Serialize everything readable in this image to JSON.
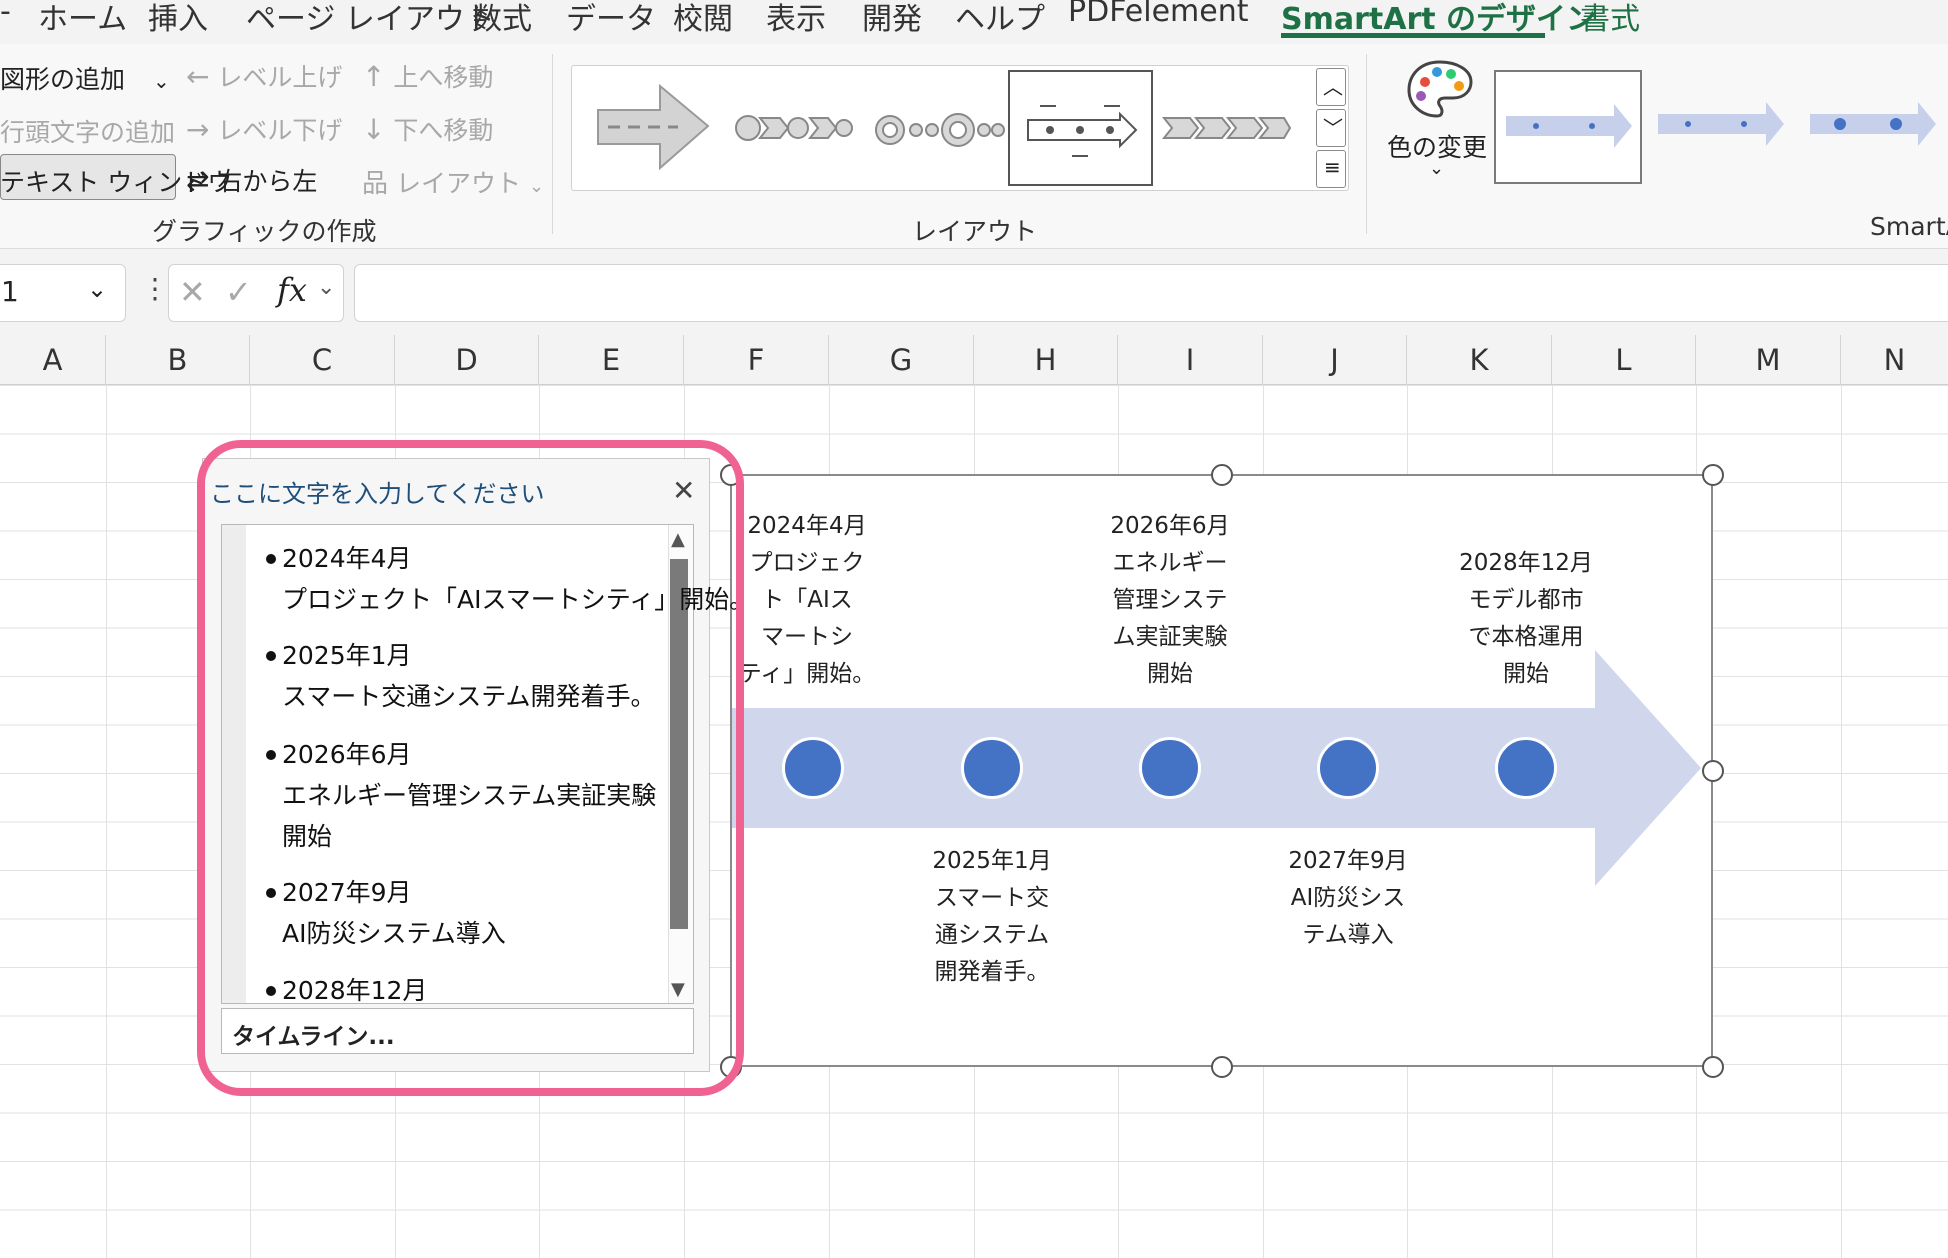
{
  "ribbon_tabs": [
    "ホーム",
    "挿入",
    "ページ レイアウト",
    "数式",
    "データ",
    "校閲",
    "表示",
    "開発",
    "ヘルプ",
    "PDFelement",
    "SmartArt のデザイン",
    "書式"
  ],
  "create_graphic": {
    "add_shape": "図形の追加",
    "add_bullet": "行頭文字の追加",
    "text_pane": "テキスト ウィンドウ",
    "promote": "レベル上げ",
    "demote": "レベル下げ",
    "right_to_left": "右から左",
    "move_up": "上へ移動",
    "move_down": "下へ移動",
    "layout": "レイアウト",
    "group_label": "グラフィックの作成"
  },
  "layouts": {
    "group_label": "レイアウト"
  },
  "color_change": "色の変更",
  "styles_group_label": "SmartA",
  "name_box_value": "1",
  "fx_label": "fx",
  "columns": [
    "A",
    "B",
    "C",
    "D",
    "E",
    "F",
    "G",
    "H",
    "I",
    "J",
    "K",
    "L",
    "M",
    "N"
  ],
  "text_pane": {
    "title": "ここに文字を入力してください",
    "items": [
      {
        "line1": "2024年4月",
        "line2": "プロジェクト「AIスマートシティ」開始。"
      },
      {
        "line1": "2025年1月",
        "line2": "スマート交通システム開発着手。"
      },
      {
        "line1": "2026年6月",
        "line2": "エネルギー管理システム実証実験",
        "line3": "開始"
      },
      {
        "line1": "2027年9月",
        "line2": "AI防災システム導入"
      },
      {
        "line1": "2028年12月"
      }
    ],
    "footer": "タイムライン..."
  },
  "timeline": {
    "labels": [
      {
        "lines": [
          "2024年4月",
          "プロジェク",
          "ト「AIス",
          "マートシ",
          "ティ」開始。"
        ]
      },
      {
        "lines": [
          "2025年1月",
          "スマート交",
          "通システム",
          "開発着手。"
        ]
      },
      {
        "lines": [
          "2026年6月",
          "エネルギー",
          "管理システ",
          "ム実証実験",
          "開始"
        ]
      },
      {
        "lines": [
          "2027年9月",
          "AI防災シス",
          "テム導入"
        ]
      },
      {
        "lines": [
          "2028年12月",
          "モデル都市",
          "で本格運用",
          "開始"
        ]
      }
    ],
    "arrow_color": "#d0d7ec",
    "dot_color": "#4472c4"
  },
  "accent_color": "#1e7145",
  "highlight_color": "#f06292"
}
